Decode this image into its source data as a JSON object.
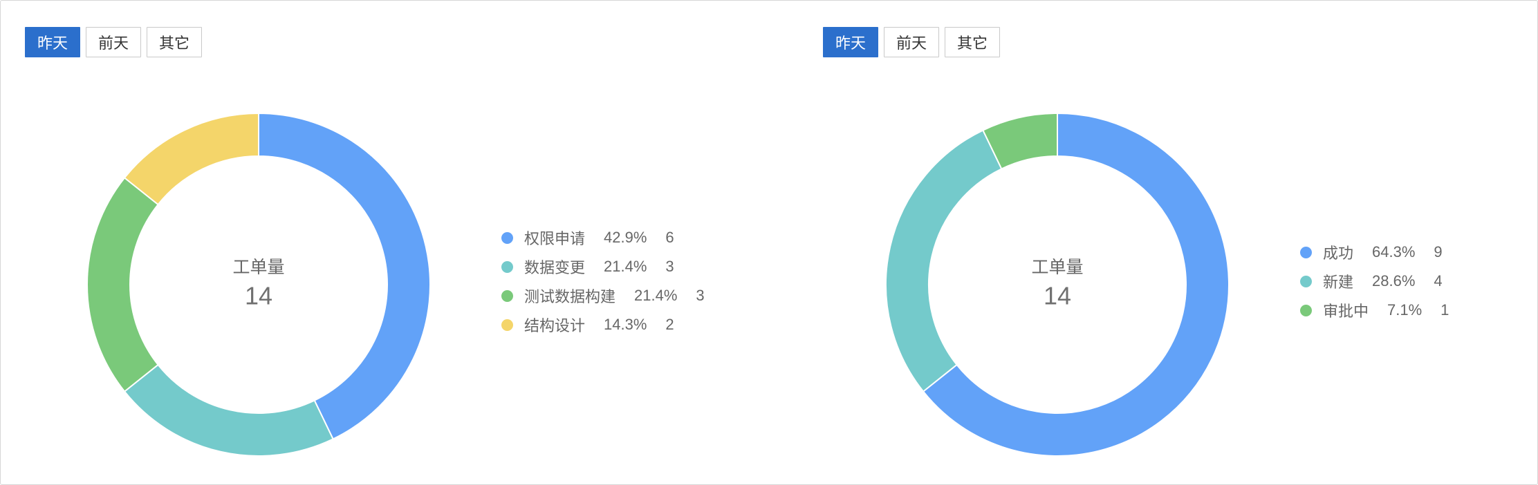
{
  "colors": {
    "accent": "#2b6fcc",
    "text": "#666666",
    "border": "#c9c9c9"
  },
  "panels": [
    {
      "tabs": [
        {
          "label": "昨天",
          "active": true
        },
        {
          "label": "前天",
          "active": false
        },
        {
          "label": "其它",
          "active": false
        }
      ]
    },
    {
      "tabs": [
        {
          "label": "昨天",
          "active": true
        },
        {
          "label": "前天",
          "active": false
        },
        {
          "label": "其它",
          "active": false
        }
      ]
    }
  ],
  "chart_data": [
    {
      "type": "pie",
      "style": "donut",
      "center_label": "工单量",
      "center_value": "14",
      "categories": [
        "权限申请",
        "数据变更",
        "测试数据构建",
        "结构设计"
      ],
      "values": [
        6,
        3,
        3,
        2
      ],
      "percent_labels": [
        "42.9%",
        "21.4%",
        "21.4%",
        "14.3%"
      ],
      "colors": [
        "#62a2f8",
        "#74cacb",
        "#7ac97a",
        "#f4d56a"
      ],
      "legend": "right"
    },
    {
      "type": "pie",
      "style": "donut",
      "center_label": "工单量",
      "center_value": "14",
      "categories": [
        "成功",
        "新建",
        "审批中"
      ],
      "values": [
        9,
        4,
        1
      ],
      "percent_labels": [
        "64.3%",
        "28.6%",
        "7.1%"
      ],
      "colors": [
        "#62a2f8",
        "#74cacb",
        "#7ac97a"
      ],
      "legend": "right"
    }
  ]
}
